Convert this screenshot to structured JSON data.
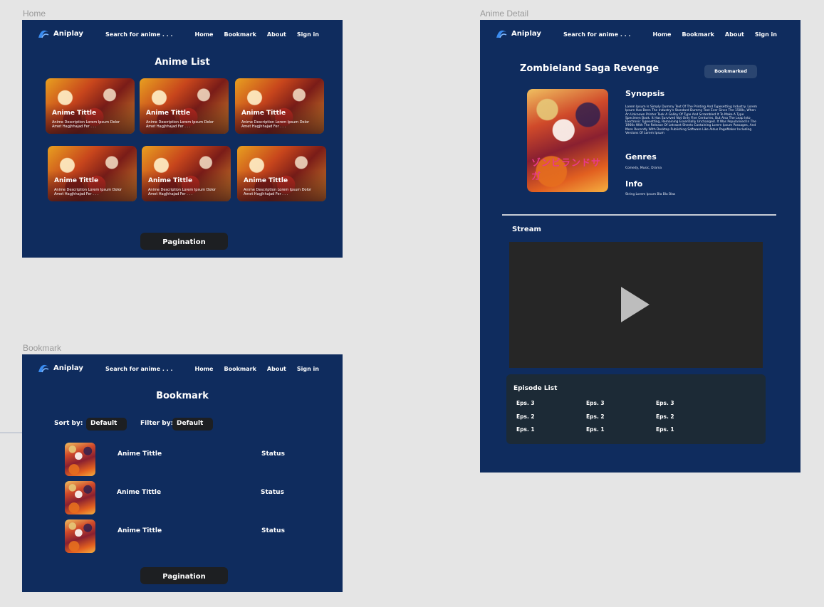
{
  "frames": {
    "home_label": "Home",
    "bookmark_label": "Bookmark",
    "detail_label": "Anime Detail"
  },
  "nav": {
    "brand": "Aniplay",
    "search_placeholder": "Search for anime . . .",
    "links": [
      "Home",
      "Bookmark",
      "About",
      "Sign in"
    ]
  },
  "home": {
    "title": "Anime List",
    "cards": [
      {
        "title": "Anime Tittle",
        "description": "Anime Description Lorem Ipsum Dolor Amet Hagjhhajad Fer . . ."
      },
      {
        "title": "Anime Tittle",
        "description": "Anime Description Lorem Ipsum Dolor Amet Hagjhhajad Fer . . ."
      },
      {
        "title": "Anime Tittle",
        "description": "Anime Description Lorem Ipsum Dolor Amet Hagjhhajad Fer . . ."
      },
      {
        "title": "Anime Tittle",
        "description": "Anime Description Lorem Ipsum Dolor Amet Hagjhhajad Fer . . ."
      },
      {
        "title": "Anime Tittle",
        "description": "Anime Description Lorem Ipsum Dolor Amet Hagjhhajad Fer . . ."
      },
      {
        "title": "Anime Tittle",
        "description": "Anime Description Lorem Ipsum Dolor Amet Hagjhhajad Fer . . ."
      }
    ],
    "pagination": "Pagination"
  },
  "bookmark": {
    "title": "Bookmark",
    "sort_label": "Sort by:",
    "sort_value": "Default",
    "filter_label": "Filter by:",
    "filter_value": "Default",
    "rows": [
      {
        "title": "Anime Tittle",
        "status": "Status"
      },
      {
        "title": "Anime Tittle",
        "status": "Status"
      },
      {
        "title": "Anime Tittle",
        "status": "Status"
      }
    ],
    "pagination": "Pagination"
  },
  "detail": {
    "title": "Zombieland Saga Revenge",
    "bookmark_button": "Bookmarked",
    "poster_text": "ゾンビランドサガ",
    "synopsis_heading": "Synopsis",
    "synopsis": "Lorem Ipsum Is Simply Dummy Text Of The Printing And Typesetting Industry. Lorem Ipsum Has Been The Industry's Standard Dummy Text Ever Since The 1500s, When An Unknown Printer Took A Galley Of Type And Scrambled It To Make A Type Specimen Book. It Has Survived Not Only Five Centuries, But Also The Leap Into Electronic Typesetting, Remaining Essentially Unchanged. It Was Popularised In The 1960s With The Release Of Letraset Sheets Containing Lorem Ipsum Passages, And More Recently With Desktop Publishing Software Like Aldus PageMaker Including Versions Of Lorem Ipsum",
    "genres_heading": "Genres",
    "genres": "Comedy, Music, Drama",
    "info_heading": "Info",
    "info": "String Lorem Ipsum Bla Bla Blas",
    "stream_label": "Stream",
    "episode_list_title": "Episode List",
    "episodes": [
      [
        "Eps. 3",
        "Eps. 3",
        "Eps. 3"
      ],
      [
        "Eps. 2",
        "Eps. 2",
        "Eps. 2"
      ],
      [
        "Eps. 1",
        "Eps. 1",
        "Eps. 1"
      ]
    ]
  },
  "colors": {
    "canvas": "#e5e5e5",
    "frame_bg": "#0f2c5e",
    "button_dark": "#1d1f22",
    "player_bg": "#262626",
    "episode_box": "#1c2a36",
    "logo_blue": "#3a8cf0"
  }
}
